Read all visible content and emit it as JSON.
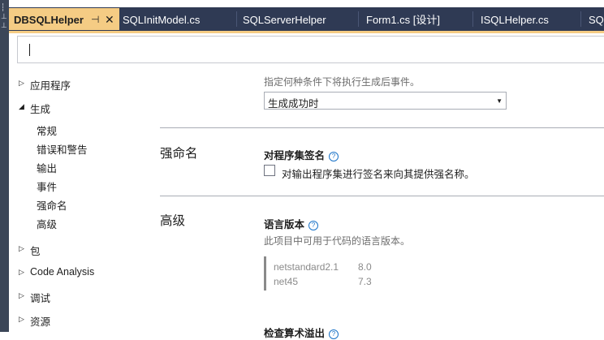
{
  "tabs": [
    {
      "label": "DBSQLHelper",
      "active": true
    },
    {
      "label": "SQLInitModel.cs"
    },
    {
      "label": "SQLServerHelper"
    },
    {
      "label": "Form1.cs [设计]"
    },
    {
      "label": "ISQLHelper.cs"
    },
    {
      "label": "SQ"
    }
  ],
  "tab_pin_icon": "⊣",
  "tab_close_icon": "✕",
  "search": {
    "value": ""
  },
  "nav": {
    "app": "应用程序",
    "build": "生成",
    "build_children": [
      "常规",
      "错误和警告",
      "输出",
      "事件",
      "强命名",
      "高级"
    ],
    "package": "包",
    "code_analysis": "Code Analysis",
    "debug": "调试",
    "resources": "资源"
  },
  "events": {
    "hint": "指定何种条件下将执行生成后事件。",
    "select_value": "生成成功时"
  },
  "strong_name": {
    "heading": "强命名",
    "title": "对程序集签名",
    "checkbox_label": "对输出程序集进行签名来向其提供强名称。",
    "checked": false
  },
  "advanced": {
    "heading": "高级",
    "lang_title": "语言版本",
    "lang_hint": "此项目中可用于代码的语言版本。",
    "lang_versions": [
      {
        "framework": "netstandard2.1",
        "version": "8.0"
      },
      {
        "framework": "net45",
        "version": "7.3"
      }
    ],
    "overflow_title": "检查算术溢出"
  },
  "colors": {
    "tab_active": "#f5cc84",
    "tabbar": "#2f3a54",
    "help": "#1a73c8"
  }
}
